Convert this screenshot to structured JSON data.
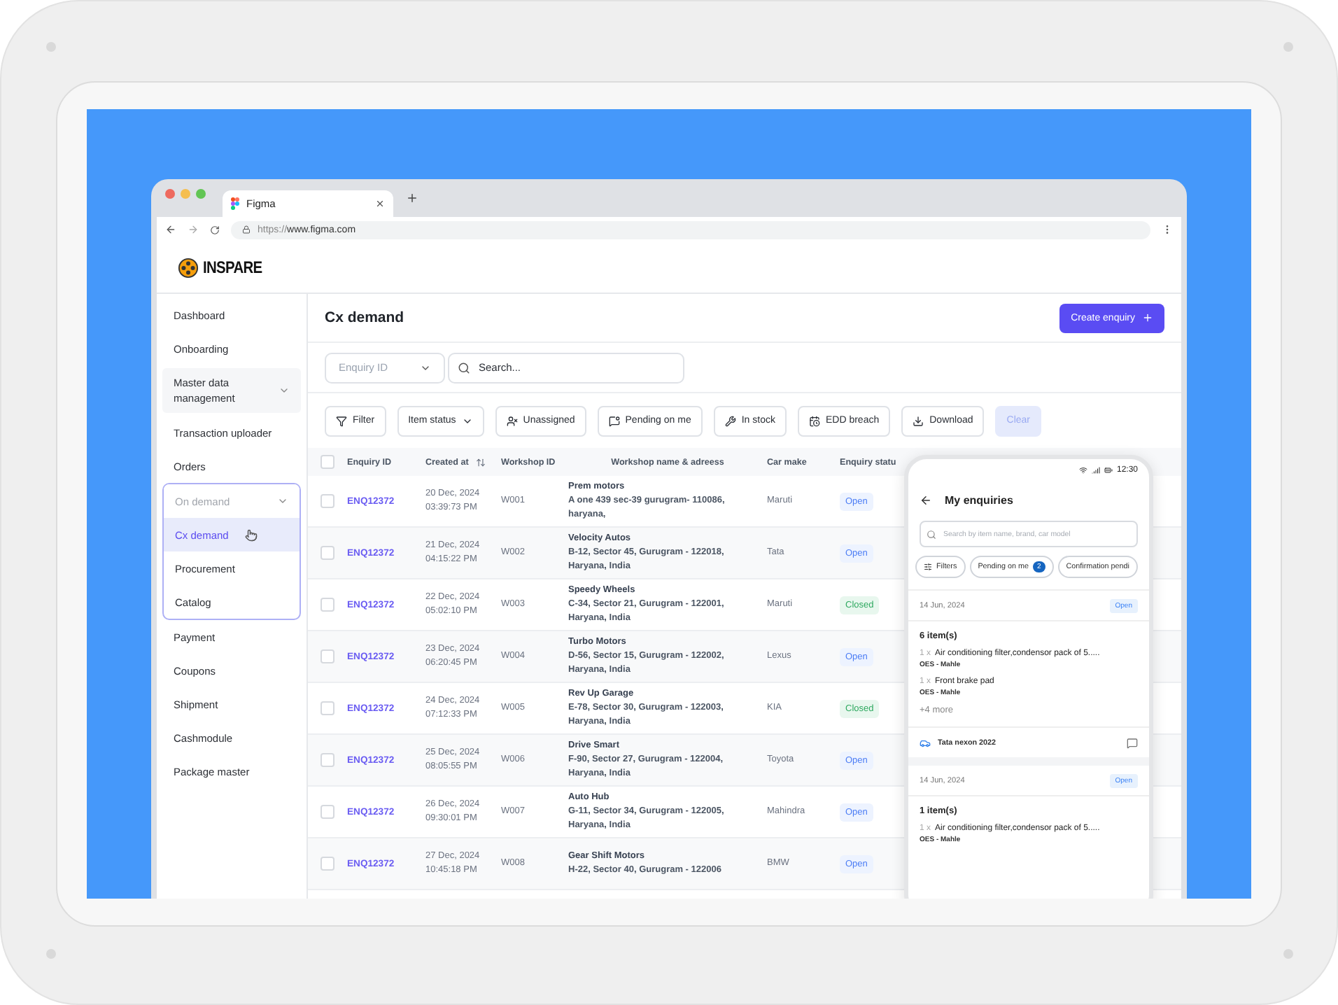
{
  "browser": {
    "tab_title": "Figma",
    "url_scheme": "https://",
    "url_host": "www.figma.com"
  },
  "brand": {
    "name": "INSPARE"
  },
  "sidebar": {
    "items": [
      {
        "label": "Dashboard",
        "kind": "link",
        "selected": false
      },
      {
        "label": "Onboarding",
        "kind": "link",
        "selected": false
      },
      {
        "label": "Master data management",
        "kind": "group",
        "selected": false,
        "expanded": false
      },
      {
        "label": "Transaction uploader",
        "kind": "link",
        "selected": false
      },
      {
        "label": "Orders",
        "kind": "link",
        "selected": false
      },
      {
        "label": "On demand",
        "kind": "group",
        "selected": false,
        "expanded": true,
        "children": [
          {
            "label": "Cx demand",
            "selected": true
          },
          {
            "label": "Procurement",
            "selected": false
          },
          {
            "label": "Catalog",
            "selected": false
          }
        ]
      },
      {
        "label": "Payment",
        "kind": "link",
        "selected": false
      },
      {
        "label": "Coupons",
        "kind": "link",
        "selected": false
      },
      {
        "label": "Shipment",
        "kind": "link",
        "selected": false
      },
      {
        "label": "Cashmodule",
        "kind": "link",
        "selected": false
      },
      {
        "label": "Package master",
        "kind": "link",
        "selected": false
      }
    ]
  },
  "page": {
    "title": "Cx demand",
    "create_button": "Create enquiry"
  },
  "filters": {
    "id_select": {
      "placeholder": "Enquiry ID"
    },
    "search": {
      "placeholder": "Search..."
    }
  },
  "toolbar": {
    "chips": [
      {
        "label": "Filter",
        "kind": "filter",
        "disabled": false
      },
      {
        "label": "Item status",
        "kind": "dropdown",
        "disabled": false
      },
      {
        "label": "Unassigned",
        "kind": "unassigned",
        "disabled": false
      },
      {
        "label": "Pending on me",
        "kind": "pending",
        "disabled": false
      },
      {
        "label": "In stock",
        "kind": "stock",
        "disabled": false
      },
      {
        "label": "EDD breach",
        "kind": "edd",
        "disabled": false
      },
      {
        "label": "Download",
        "kind": "download",
        "disabled": false
      },
      {
        "label": "Clear",
        "kind": "plain",
        "disabled": true
      }
    ]
  },
  "table": {
    "select_all_checked": false,
    "columns": [
      {
        "label": "Enquiry ID",
        "sortable": false
      },
      {
        "label": "Created at",
        "sortable": true
      },
      {
        "label": "Workshop ID",
        "sortable": false
      },
      {
        "label": "Workshop name & adreess",
        "sortable": false
      },
      {
        "label": "Car make",
        "sortable": false
      },
      {
        "label": "Enquiry statu",
        "sortable": false
      }
    ],
    "rows": [
      {
        "checked": false,
        "id": "ENQ12372",
        "date": "20 Dec, 2024",
        "time": "03:39:73 PM",
        "workshop_id": "W001",
        "workshop_name": "Prem motors",
        "address_lines": [
          "A one 439 sec-39 gurugram- 110086,",
          "haryana,"
        ],
        "car_make": "Maruti",
        "status": {
          "label": "Open",
          "kind": "open"
        }
      },
      {
        "checked": false,
        "id": "ENQ12372",
        "date": "21 Dec, 2024",
        "time": "04:15:22 PM",
        "workshop_id": "W002",
        "workshop_name": "Velocity Autos",
        "address_lines": [
          "B-12, Sector 45, Gurugram - 122018,",
          "Haryana, India"
        ],
        "car_make": "Tata",
        "status": {
          "label": "Open",
          "kind": "open"
        }
      },
      {
        "checked": false,
        "id": "ENQ12372",
        "date": "22 Dec, 2024",
        "time": "05:02:10 PM",
        "workshop_id": "W003",
        "workshop_name": "Speedy Wheels",
        "address_lines": [
          "C-34, Sector 21, Gurugram - 122001,",
          "Haryana, India"
        ],
        "car_make": "Maruti",
        "status": {
          "label": "Closed",
          "kind": "closed"
        }
      },
      {
        "checked": false,
        "id": "ENQ12372",
        "date": "23 Dec, 2024",
        "time": "06:20:45 PM",
        "workshop_id": "W004",
        "workshop_name": "Turbo Motors",
        "address_lines": [
          "D-56, Sector 15, Gurugram - 122002,",
          "Haryana, India"
        ],
        "car_make": "Lexus",
        "status": {
          "label": "Open",
          "kind": "open"
        }
      },
      {
        "checked": false,
        "id": "ENQ12372",
        "date": "24 Dec, 2024",
        "time": "07:12:33 PM",
        "workshop_id": "W005",
        "workshop_name": "Rev Up Garage",
        "address_lines": [
          "E-78, Sector 30, Gurugram - 122003,",
          "Haryana, India"
        ],
        "car_make": "KIA",
        "status": {
          "label": "Closed",
          "kind": "closed"
        }
      },
      {
        "checked": false,
        "id": "ENQ12372",
        "date": "25 Dec, 2024",
        "time": "08:05:55 PM",
        "workshop_id": "W006",
        "workshop_name": "Drive Smart",
        "address_lines": [
          "F-90, Sector 27, Gurugram - 122004,",
          "Haryana, India"
        ],
        "car_make": "Toyota",
        "status": {
          "label": "Open",
          "kind": "open"
        }
      },
      {
        "checked": false,
        "id": "ENQ12372",
        "date": "26 Dec, 2024",
        "time": "09:30:01 PM",
        "workshop_id": "W007",
        "workshop_name": "Auto Hub",
        "address_lines": [
          "G-11, Sector 34, Gurugram - 122005,",
          "Haryana, India"
        ],
        "car_make": "Mahindra",
        "status": {
          "label": "Open",
          "kind": "open"
        }
      },
      {
        "checked": false,
        "id": "ENQ12372",
        "date": "27 Dec, 2024",
        "time": "10:45:18 PM",
        "workshop_id": "W008",
        "workshop_name": "Gear Shift Motors",
        "address_lines": [
          "H-22, Sector 40, Gurugram - 122006"
        ],
        "car_make": "BMW",
        "status": {
          "label": "Open",
          "kind": "open"
        }
      }
    ]
  },
  "phone": {
    "time": "12:30",
    "title": "My enquiries",
    "search": {
      "placeholder": "Search by item name, brand, car model"
    },
    "chips": [
      {
        "label": "Filters",
        "kind": "icon"
      },
      {
        "label": "Pending on me",
        "kind": "count",
        "count": "2"
      },
      {
        "label": "Confirmation pendi",
        "kind": "plain"
      }
    ],
    "cards": [
      {
        "date": "14 Jun, 2024",
        "status": {
          "label": "Open",
          "kind": "open"
        },
        "count": "6 item(s)",
        "items": [
          {
            "qty": "1 x",
            "name": "Air conditioning filter,condensor pack of 5.....",
            "brand": "OES - Mahle"
          },
          {
            "qty": "1 x",
            "name": "Front brake pad",
            "brand": "OES - Mahle"
          }
        ],
        "more": "+4 more",
        "car": "Tata nexon 2022"
      },
      {
        "date": "14 Jun, 2024",
        "status": {
          "label": "Open",
          "kind": "open"
        },
        "count": "1 item(s)",
        "items": [
          {
            "qty": "1 x",
            "name": "Air conditioning filter,condensor pack of 5.....",
            "brand": "OES - Mahle"
          }
        ]
      }
    ]
  }
}
